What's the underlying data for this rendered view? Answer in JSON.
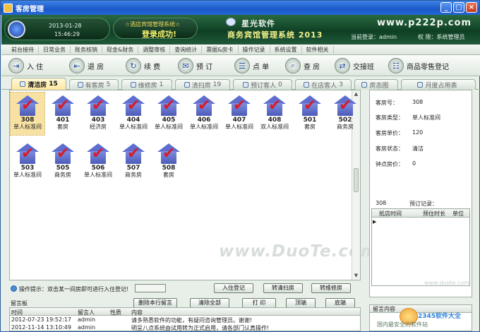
{
  "window": {
    "title": "客房管理",
    "controls": [
      "minimize",
      "maximize",
      "close"
    ]
  },
  "banner": {
    "date": "2013-01-28",
    "time": "15:46:29",
    "system_name": "☆酒店宾馆管理系统☆",
    "login_status": "登录成功!",
    "brand_company": "星光软件",
    "brand_product": "商务宾馆管理系统 2013",
    "url": "www.p222p.com",
    "current_user_label": "当前登录：",
    "current_user": "admin",
    "role_label": "权 限：",
    "role": "系统管理员"
  },
  "menubar": [
    "前台接待",
    "日常业务",
    "账务核销",
    "现金&财务",
    "调整审核",
    "查询统计",
    "票据&房卡",
    "操作记录",
    "系统设置",
    "软件相关"
  ],
  "toolbar": [
    {
      "label": "入 住",
      "icon": "checkin-icon"
    },
    {
      "label": "退 房",
      "icon": "checkout-icon"
    },
    {
      "label": "续 费",
      "icon": "renew-icon"
    },
    {
      "label": "预 订",
      "icon": "reserve-icon"
    },
    {
      "label": "点 单",
      "icon": "order-icon"
    },
    {
      "label": "查 房",
      "icon": "inspect-icon"
    },
    {
      "label": "交接班",
      "icon": "shift-icon"
    },
    {
      "label": "商品零售登记",
      "icon": "retail-icon"
    }
  ],
  "tabs": [
    {
      "label": "清洁房",
      "count": "15",
      "active": true
    },
    {
      "label": "有客房",
      "count": "5"
    },
    {
      "label": "维修房",
      "count": "1"
    },
    {
      "label": "清扫房",
      "count": "19"
    },
    {
      "label": "预订客人",
      "count": "0"
    },
    {
      "label": "在店客人",
      "count": "3"
    },
    {
      "label": "房态图",
      "count": ""
    },
    {
      "label": "月度占用表",
      "count": ""
    }
  ],
  "rooms": [
    {
      "number": "308",
      "type": "单人标准间",
      "selected": true
    },
    {
      "number": "401",
      "type": "套房"
    },
    {
      "number": "403",
      "type": "经济房"
    },
    {
      "number": "404",
      "type": "单人标准间"
    },
    {
      "number": "405",
      "type": "单人标准间"
    },
    {
      "number": "406",
      "type": "单人标准间"
    },
    {
      "number": "407",
      "type": "单人标准间"
    },
    {
      "number": "408",
      "type": "双人标准间"
    },
    {
      "number": "501",
      "type": "套房"
    },
    {
      "number": "502",
      "type": "商务房"
    },
    {
      "number": "503",
      "type": "单人标准间"
    },
    {
      "number": "505",
      "type": "商务房"
    },
    {
      "number": "506",
      "type": "单人标准间"
    },
    {
      "number": "507",
      "type": "商务房"
    },
    {
      "number": "508",
      "type": "套房"
    }
  ],
  "watermark": "www.DuoTe.com",
  "hint": {
    "text": "操作提示：双击某一间房即可进行入住登记!",
    "buttons": [
      "入住登记",
      "转清扫房",
      "转维修房"
    ]
  },
  "room_details": {
    "number_label": "客房号：",
    "number": "308",
    "type_label": "客房类型：",
    "type": "单人标准间",
    "price_label": "客房单价：",
    "price": "120",
    "status_label": "客房状态：",
    "status": "清洁",
    "hourly_label": "钟点房价：",
    "hourly": "0"
  },
  "reservation": {
    "room": "308",
    "label": "预订记录：",
    "columns": [
      "抵店时间",
      "预住时长",
      "单位"
    ]
  },
  "message_board": {
    "title": "留言板",
    "buttons": [
      "删除本行留言",
      "清除全部",
      "打 印",
      "顶端",
      "底端"
    ],
    "columns": [
      "时间",
      "留言人",
      "性质",
      "内容"
    ],
    "rows": [
      {
        "time": "2012-07-23 19:52:17",
        "author": "admin",
        "kind": "",
        "content": "请多熟悉软件的功能，有疑问咨询管理员。谢谢!"
      },
      {
        "time": "2012-11-14 13:10:49",
        "author": "admin",
        "kind": "",
        "content": "明呈八点系统由试用转为正式启用，请各部门认真操作!"
      }
    ]
  },
  "message_content": {
    "header": "留言内容",
    "note": "国内最安全的软件站",
    "logo_text": "2345软件大全"
  },
  "corner_watermark": "www.duote.com"
}
